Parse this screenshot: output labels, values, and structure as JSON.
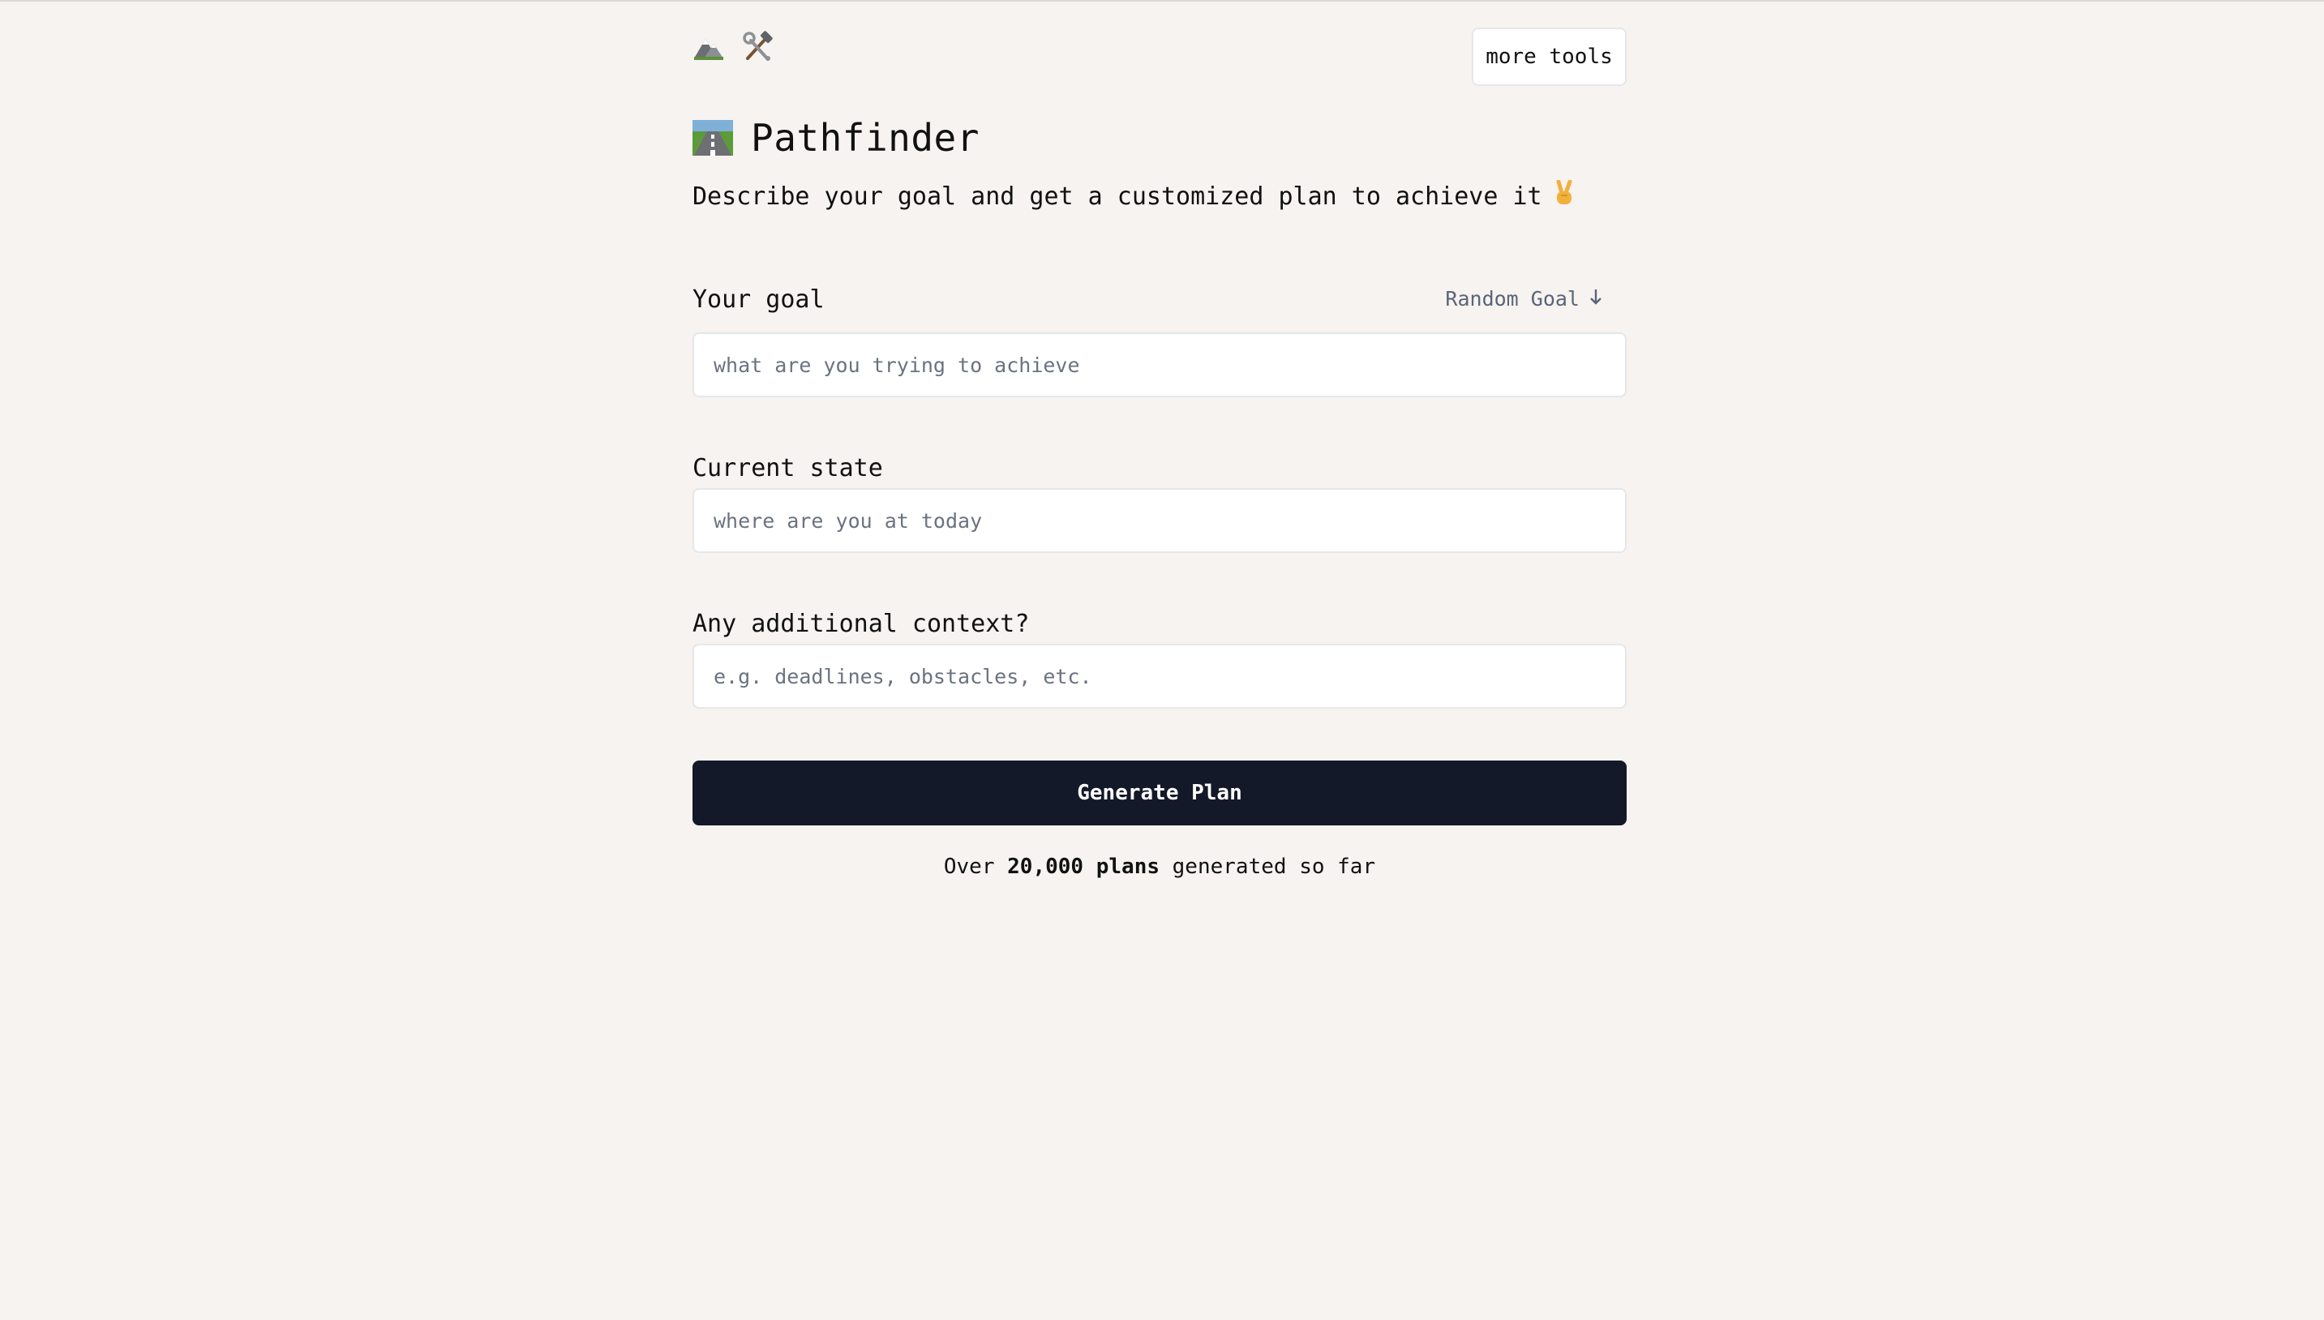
{
  "header": {
    "logo_icons": [
      "mountain-icon",
      "hammer-wrench-icon"
    ],
    "more_tools_label": "more tools"
  },
  "app": {
    "title_icon": "road-icon",
    "title": "Pathfinder",
    "subtitle": "Describe your goal and get a customized plan to achieve it",
    "subtitle_icon": "victory-hand-icon"
  },
  "form": {
    "goal": {
      "label": "Your goal",
      "random_label": "Random Goal",
      "random_icon": "arrow-down-icon",
      "placeholder": "what are you trying to achieve",
      "value": ""
    },
    "current_state": {
      "label": "Current state",
      "placeholder": "where are you at today",
      "value": ""
    },
    "context": {
      "label": "Any additional context?",
      "placeholder": "e.g. deadlines, obstacles, etc.",
      "value": ""
    },
    "submit_label": "Generate Plan"
  },
  "stats": {
    "prefix": "Over",
    "count": "20,000 plans",
    "suffix": "generated so far"
  },
  "colors": {
    "background": "#f6f3f0",
    "button_bg": "#131928",
    "muted_text": "#5b6478",
    "border": "#e5e7eb"
  }
}
